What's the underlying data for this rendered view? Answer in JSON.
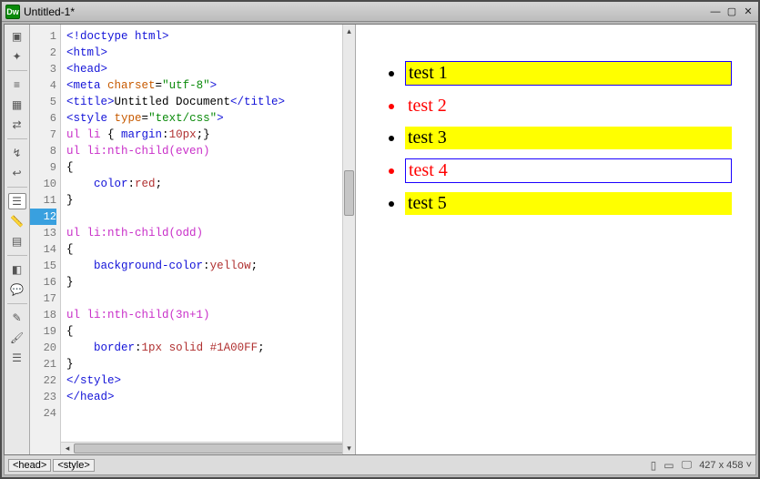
{
  "window": {
    "title": "Untitled-1*",
    "app_abbrev": "Dw"
  },
  "code": {
    "visible_lines": 24,
    "selected_line": 12,
    "lines": [
      {
        "n": 1,
        "html": "<span class='tag'>&lt;!doctype html&gt;</span>"
      },
      {
        "n": 2,
        "html": "<span class='tag'>&lt;html&gt;</span>"
      },
      {
        "n": 3,
        "html": "<span class='tag'>&lt;head&gt;</span>"
      },
      {
        "n": 4,
        "html": "<span class='tag'>&lt;meta</span> <span class='attr'>charset</span>=<span class='val'>\"utf-8\"</span><span class='tag'>&gt;</span>"
      },
      {
        "n": 5,
        "html": "<span class='tag'>&lt;title&gt;</span><span class='txt'>Untitled Document</span><span class='tag'>&lt;/title&gt;</span>"
      },
      {
        "n": 6,
        "html": "<span class='tag'>&lt;style</span> <span class='attr'>type</span>=<span class='val'>\"text/css\"</span><span class='tag'>&gt;</span>"
      },
      {
        "n": 7,
        "html": "<span class='sel-css'>ul li</span> { <span class='prop'>margin</span>:<span class='num'>10px</span>;}"
      },
      {
        "n": 8,
        "html": "<span class='sel-css'>ul li:nth-child(even)</span>"
      },
      {
        "n": 9,
        "html": "{"
      },
      {
        "n": 10,
        "html": "    <span class='prop'>color</span>:<span class='num'>red</span>;"
      },
      {
        "n": 11,
        "html": "}"
      },
      {
        "n": 12,
        "html": " "
      },
      {
        "n": 13,
        "html": "<span class='sel-css'>ul li:nth-child(odd)</span>"
      },
      {
        "n": 14,
        "html": "{"
      },
      {
        "n": 15,
        "html": "    <span class='prop'>background-color</span>:<span class='num'>yellow</span>;"
      },
      {
        "n": 16,
        "html": "}"
      },
      {
        "n": 17,
        "html": " "
      },
      {
        "n": 18,
        "html": "<span class='sel-css'>ul li:nth-child(3n+1)</span>"
      },
      {
        "n": 19,
        "html": "{"
      },
      {
        "n": 20,
        "html": "    <span class='prop'>border</span>:<span class='num'>1px</span> <span class='num'>solid</span> <span class='num'>#1A00FF</span>;"
      },
      {
        "n": 21,
        "html": "}"
      },
      {
        "n": 22,
        "html": "<span class='tag'>&lt;/style&gt;</span>"
      },
      {
        "n": 23,
        "html": "<span class='tag'>&lt;/head&gt;</span>"
      },
      {
        "n": 24,
        "html": " "
      }
    ]
  },
  "preview": {
    "items": [
      "test 1",
      "test 2",
      "test 3",
      "test 4",
      "test 5"
    ]
  },
  "status": {
    "breadcrumbs": [
      "<head>",
      "<style>"
    ],
    "dimensions": "427 x 458",
    "dim_suffix": " ˅"
  },
  "sidebar_icons": [
    "view-icon",
    "wand-icon",
    "sep",
    "align-icon",
    "grid-icon",
    "arrows-icon",
    "sep",
    "lightning-icon",
    "wrap-icon",
    "sep",
    "list-icon",
    "ruler-icon",
    "panel-icon",
    "sep",
    "nav-icon",
    "comment-icon",
    "sep",
    "highlight-icon",
    "brush-icon",
    "menu-icon"
  ]
}
